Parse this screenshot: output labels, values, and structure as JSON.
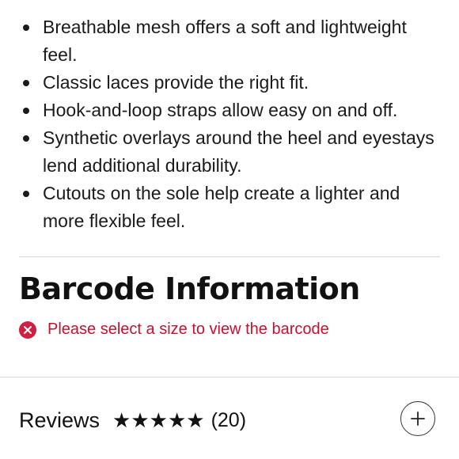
{
  "features": [
    {
      "text": "Breathable mesh offers a soft and lightweight feel."
    },
    {
      "text": "Classic laces provide the right fit."
    },
    {
      "text": "Hook-and-loop straps allow easy on and off."
    },
    {
      "text": "Synthetic overlays around the heel and eyestays lend additional durability."
    },
    {
      "text": "Cutouts on the sole help create a lighter and more flexible feel."
    }
  ],
  "barcode": {
    "title": "Barcode Information",
    "error_icon": "error-x-circle-icon",
    "error_message": "Please select a size to view the barcode",
    "error_color": "#c8102e"
  },
  "reviews": {
    "label": "Reviews",
    "rating_stars": 5,
    "stars_text": "★★★★★",
    "count": "(20)",
    "expand_icon": "plus-icon"
  }
}
